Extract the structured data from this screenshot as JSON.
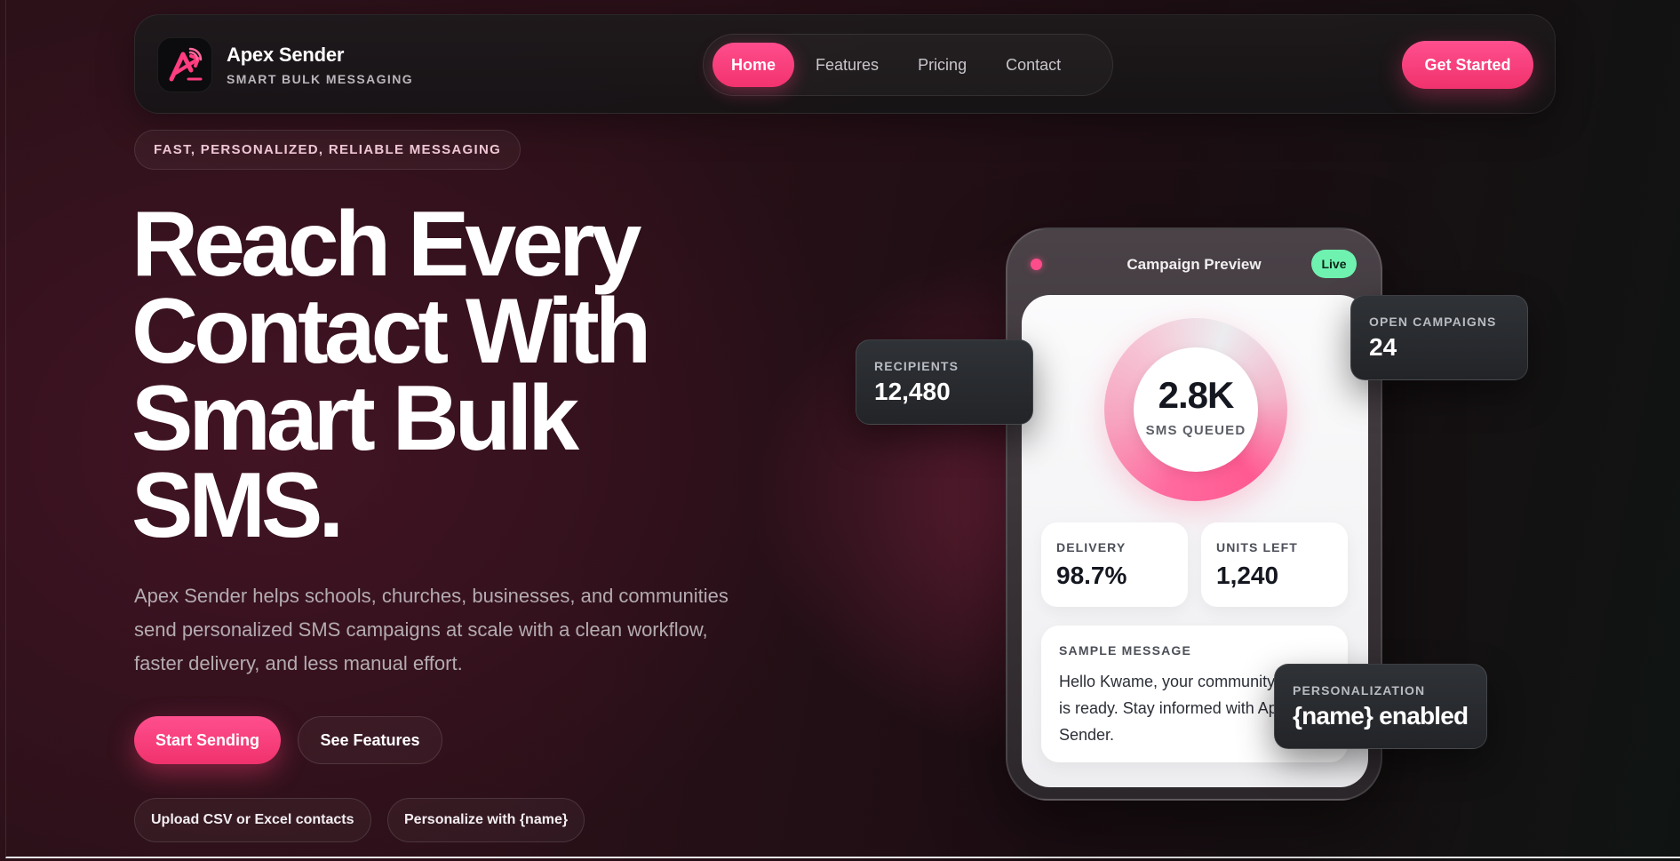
{
  "brand": {
    "name": "Apex Sender",
    "tagline": "SMART BULK MESSAGING"
  },
  "nav": {
    "items": [
      {
        "label": "Home",
        "active": true
      },
      {
        "label": "Features",
        "active": false
      },
      {
        "label": "Pricing",
        "active": false
      },
      {
        "label": "Contact",
        "active": false
      }
    ],
    "cta_label": "Get Started"
  },
  "hero": {
    "eyebrow": "FAST, PERSONALIZED, RELIABLE MESSAGING",
    "headline_lines": [
      "Reach Every",
      "Contact With",
      "Smart Bulk",
      "SMS."
    ],
    "lead": "Apex Sender helps schools, churches, businesses, and communities send personalized SMS campaigns at scale with a clean workflow, faster delivery, and less manual effort.",
    "primary_button": "Start Sending",
    "secondary_button": "See Features",
    "chips": [
      "Upload CSV or Excel contacts",
      "Personalize with {name}"
    ]
  },
  "preview": {
    "title": "Campaign Preview",
    "status_badge": "Live",
    "queued_value": "2.8K",
    "queued_label": "SMS QUEUED",
    "delivery_label": "DELIVERY",
    "delivery_value": "98.7%",
    "units_label": "UNITS LEFT",
    "units_value": "1,240",
    "sample_label": "SAMPLE MESSAGE",
    "sample_text": "Hello Kwame, your community update is ready. Stay informed with Apex Sender."
  },
  "floating": {
    "recipients_label": "RECIPIENTS",
    "recipients_value": "12,480",
    "open_campaigns_label": "OPEN CAMPAIGNS",
    "open_campaigns_value": "24",
    "personalization_label": "PERSONALIZATION",
    "personalization_value": "{name} enabled"
  },
  "colors": {
    "accent": "#f2336f",
    "live": "#6ff2b0",
    "background": "#2a1018"
  },
  "icons": {
    "logo": "signal-arrow-logo-icon",
    "dot": "status-dot-icon"
  }
}
